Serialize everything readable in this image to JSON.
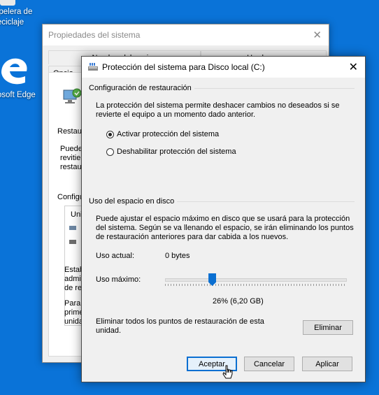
{
  "desktop": {
    "recycle_bin_label_line1": "apelera de",
    "recycle_bin_label_line2": "reciclaje",
    "edge_label": "rosoft Edge"
  },
  "back_window": {
    "title": "Propiedades del sistema",
    "tab_top_left": "Nombre del equipo",
    "tab_top_right": "Hardware",
    "tab_bottom_left": "Opcio",
    "text_restaura": "Restaura",
    "text_puede1": "Puede",
    "text_puede2": "revitie",
    "text_puede3": "restaur",
    "text_config": "Configu",
    "text_uni": "Uni",
    "text_estab1": "Estab",
    "text_estab2": "admir",
    "text_estab3": "de re",
    "text_para1": "Para",
    "text_para2": "prime",
    "text_para3": "unida"
  },
  "dialog": {
    "title": "Protección del sistema para Disco local (C:)",
    "restore_section": "Configuración de restauración",
    "restore_description": "La protección del sistema permite deshacer cambios no deseados si se revierte el equipo a un momento dado anterior.",
    "radio_enable": "Activar protección del sistema",
    "radio_disable": "Deshabilitar protección del sistema",
    "selected_option": "enable",
    "disk_section": "Uso del espacio en disco",
    "disk_description": "Puede ajustar el espacio máximo en disco que se usará para la protección del sistema. Según se va llenando el espacio, se irán eliminando los puntos de restauración anteriores para dar cabida a los nuevos.",
    "current_usage_label": "Uso actual:",
    "current_usage_value": "0 bytes",
    "max_usage_label": "Uso máximo:",
    "max_usage_fraction": 0.26,
    "max_usage_value_text": "26% (6,20 GB)",
    "delete_text": "Eliminar todos los puntos de restauración de esta unidad.",
    "delete_button": "Eliminar",
    "ok_button": "Aceptar",
    "cancel_button": "Cancelar",
    "apply_button": "Aplicar"
  },
  "colors": {
    "desktop": "#0a73d8",
    "accent": "#0a6fd1"
  }
}
